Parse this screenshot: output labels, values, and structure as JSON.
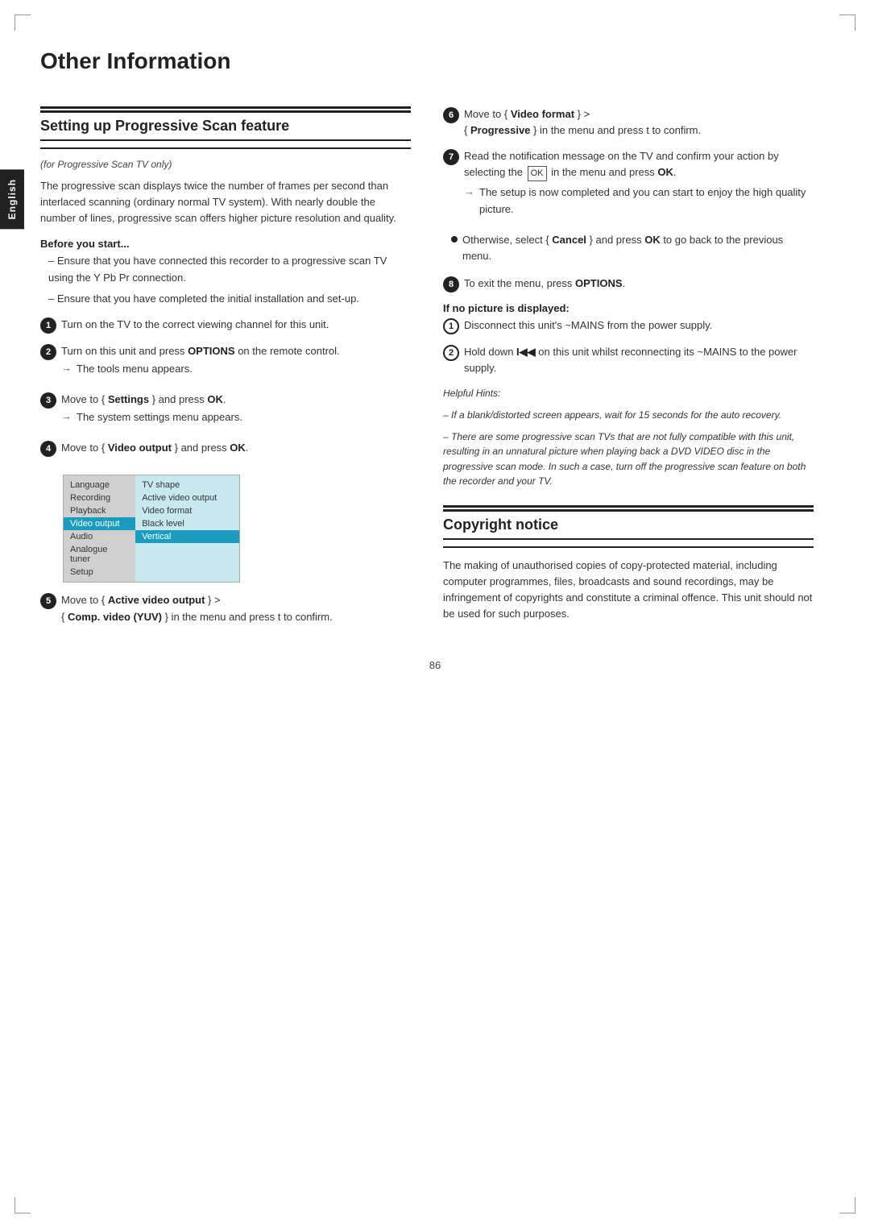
{
  "page": {
    "title": "Other Information",
    "page_number": "86",
    "side_tab": "English"
  },
  "left_section": {
    "title": "Setting up Progressive Scan feature",
    "sub": "(for Progressive Scan TV only)",
    "intro": "The progressive scan displays twice the number of frames per second than interlaced scanning (ordinary normal TV system). With nearly double the number of lines, progressive scan offers higher picture resolution and quality.",
    "before_heading": "Before you start...",
    "before_dash1": "– Ensure that you have connected this recorder to a progressive scan TV using the Y Pb Pr connection.",
    "before_dash2": "– Ensure that you have completed the initial installation and set-up.",
    "steps": [
      {
        "num": "1",
        "text": "Turn on the TV to the correct viewing channel for this unit."
      },
      {
        "num": "2",
        "text": "Turn on this unit and press OPTIONS on the remote control.",
        "sub": "The tools menu appears."
      },
      {
        "num": "3",
        "text": "Move to { Settings } and press OK.",
        "sub": "The system settings menu appears."
      },
      {
        "num": "4",
        "text": "Move to { Video output } and press OK."
      },
      {
        "num": "5",
        "text": "Move to { Active video output } > { Comp. video (YUV) } in the menu and press t to confirm."
      }
    ],
    "menu": {
      "left_items": [
        "Language",
        "Recording",
        "Playback",
        "Video output",
        "Audio",
        "Analogue tuner",
        "Setup"
      ],
      "right_items": [
        "TV shape",
        "Active video output",
        "Video format",
        "Black level",
        "Vertical"
      ],
      "active_left": "Video output",
      "highlighted_right": "Vertical"
    }
  },
  "right_section": {
    "steps_continued": [
      {
        "num": "6",
        "text": "Move to { Video format } > { Progressive } in the menu and press t to confirm."
      },
      {
        "num": "7",
        "text": "Read the notification message on the TV and confirm your action by selecting the  OK  in the menu and press OK.",
        "sub": "The setup is now completed and you can start to enjoy the high quality picture."
      },
      {
        "num": "8",
        "text": "To exit the menu, press OPTIONS."
      }
    ],
    "bullet": {
      "text": "Otherwise, select { Cancel } and press OK to go back to the previous menu."
    },
    "if_no_picture": {
      "heading": "If no picture is displayed:",
      "steps": [
        {
          "num": "1",
          "text": "Disconnect this unit's ~MAINS from the power supply."
        },
        {
          "num": "2",
          "text": "Hold down I<< on this unit whilst reconnecting its ~MAINS to the power supply."
        }
      ]
    },
    "hints": {
      "heading": "Helpful Hints:",
      "lines": [
        "– If a blank/distorted screen appears, wait for 15 seconds for the auto recovery.",
        "– There are some progressive scan TVs that are not fully compatible with this unit, resulting in an unnatural picture when playing back a DVD VIDEO disc in the progressive scan mode. In such a case, turn off the progressive scan feature on both the recorder and your TV."
      ]
    },
    "copyright": {
      "title": "Copyright notice",
      "text": "The making of unauthorised copies of copy-protected material, including computer programmes, files, broadcasts and sound recordings, may be infringement of copyrights and constitute a criminal offence.  This unit should not be used for such purposes."
    }
  }
}
